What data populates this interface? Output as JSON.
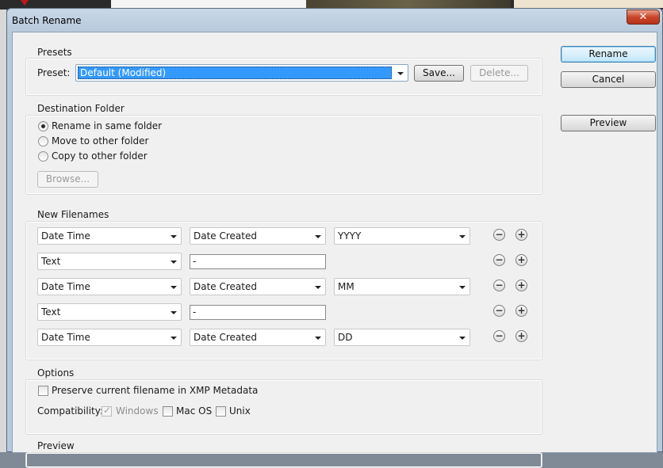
{
  "window": {
    "title": "Batch Rename",
    "close_glyph": "✕"
  },
  "buttons": {
    "rename": "Rename",
    "cancel": "Cancel",
    "preview": "Preview"
  },
  "presets": {
    "group_label": "Presets",
    "preset_label": "Preset:",
    "selected": "Default (Modified)",
    "save": "Save...",
    "delete": "Delete..."
  },
  "destination": {
    "group_label": "Destination Folder",
    "options": [
      "Rename in same folder",
      "Move to other folder",
      "Copy to other folder"
    ],
    "selected_index": 0,
    "browse": "Browse..."
  },
  "filenames": {
    "group_label": "New Filenames",
    "rows": [
      {
        "type": "Date Time",
        "field": "Date Created",
        "format": "YYYY"
      },
      {
        "type": "Text",
        "text": "-"
      },
      {
        "type": "Date Time",
        "field": "Date Created",
        "format": "MM"
      },
      {
        "type": "Text",
        "text": "-"
      },
      {
        "type": "Date Time",
        "field": "Date Created",
        "format": "DD"
      }
    ],
    "remove_glyph": "−",
    "add_glyph": "+"
  },
  "options": {
    "group_label": "Options",
    "preserve_label": "Preserve current filename in XMP Metadata",
    "preserve_checked": false,
    "compat_label": "Compatibility:",
    "windows": "Windows",
    "windows_checked": true,
    "macos": "Mac OS",
    "macos_checked": false,
    "unix": "Unix",
    "unix_checked": false,
    "check_glyph": "✓"
  },
  "preview_section": {
    "group_label": "Preview"
  },
  "colors": {
    "selection": "#3399ff",
    "default_button": "#3c7fb1",
    "close": "#c9462a"
  }
}
